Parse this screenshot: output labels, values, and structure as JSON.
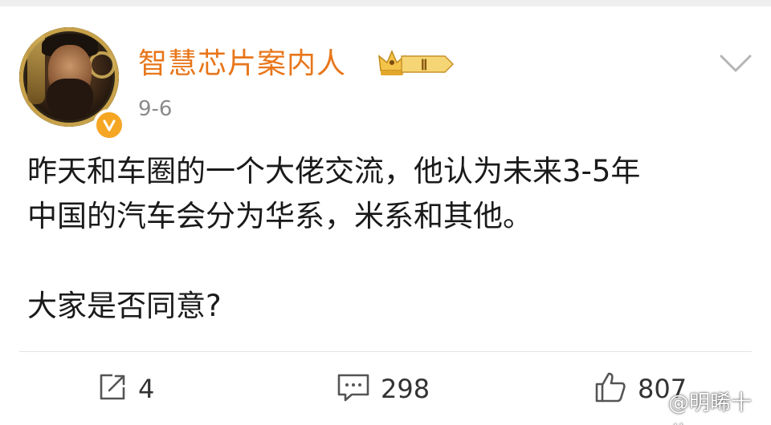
{
  "post": {
    "author": {
      "name": "智慧芯片案内人",
      "level_badge": "Ⅱ",
      "verified": true
    },
    "date": "9-6",
    "body": {
      "line1": "昨天和车圈的一个大佬交流，他认为未来3-5年",
      "line2": "中国的汽车会分为华系，米系和其他。",
      "line3": "大家是否同意?"
    },
    "actions": {
      "repost_count": "4",
      "comment_count": "298",
      "like_count": "807"
    }
  },
  "watermark": {
    "text": "@明晞十八"
  },
  "icons": {
    "verified": "verified-v-icon",
    "level": "crown-level-icon",
    "menu": "chevron-down-icon",
    "repost": "repost-icon",
    "comment": "comment-icon",
    "like": "thumbs-up-icon",
    "watermark_logo": "weibo-logo-icon"
  },
  "colors": {
    "author_name": "#e8761a",
    "verified_badge": "#f5a623",
    "text": "#1a1a1a",
    "muted": "#8a8a8a"
  }
}
